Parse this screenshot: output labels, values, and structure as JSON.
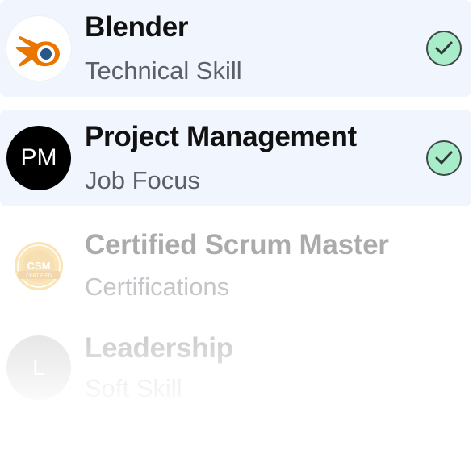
{
  "items": [
    {
      "title": "Blender",
      "subtitle": "Technical Skill",
      "avatar_icon": "blender-logo-icon",
      "selected": true
    },
    {
      "title": "Project Management",
      "subtitle": "Job Focus",
      "avatar_initials": "PM",
      "selected": true
    },
    {
      "title": "Certified Scrum Master",
      "subtitle": "Certifications",
      "avatar_icon": "csm-badge-icon",
      "avatar_badge_text": "CSM",
      "avatar_badge_ring_text": "CERTIFIED",
      "selected": false
    },
    {
      "title": "Leadership",
      "subtitle": "Soft Skill",
      "avatar_initials": "L",
      "selected": false
    }
  ],
  "colors": {
    "selected_background": "#f1f5fd",
    "check_fill": "#a9ecc9",
    "blender_orange": "#ea7600",
    "blender_blue": "#265787"
  }
}
